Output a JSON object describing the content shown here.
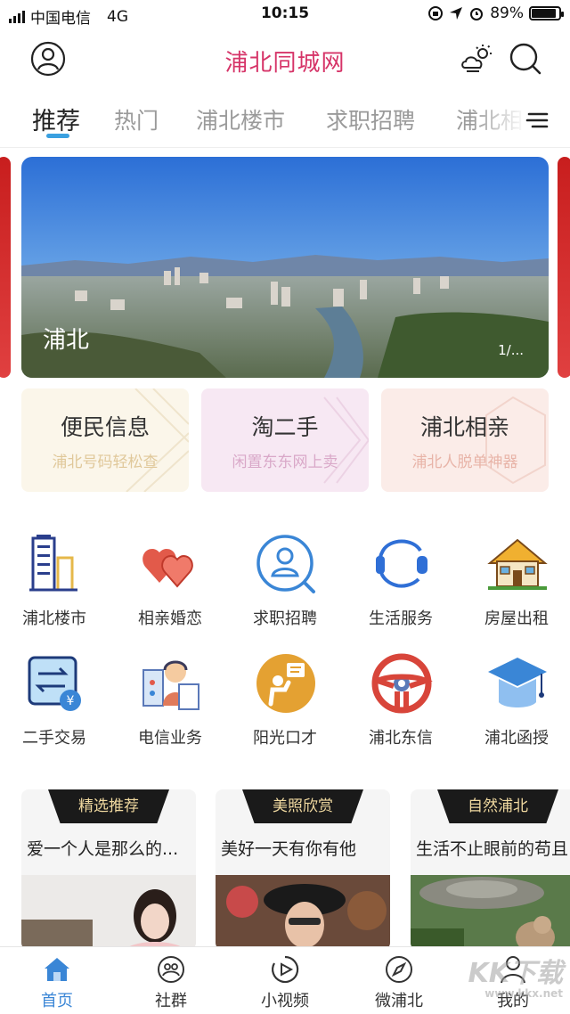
{
  "status_bar": {
    "carrier": "中国电信",
    "network": "4G",
    "time": "10:15",
    "battery": "89%",
    "battery_level": 0.89
  },
  "header": {
    "title": "浦北同城网"
  },
  "tabs": [
    {
      "label": "推荐",
      "active": true
    },
    {
      "label": "热门"
    },
    {
      "label": "浦北楼市"
    },
    {
      "label": "求职招聘"
    },
    {
      "label": "浦北相"
    }
  ],
  "banner": {
    "caption": "浦北",
    "page_indicator": "1/..."
  },
  "service_cards": [
    {
      "title": "便民信息",
      "subtitle": "浦北号码轻松查",
      "bg": "#fbf6ea",
      "subtitle_color": "#e0c89a"
    },
    {
      "title": "淘二手",
      "subtitle": "闲置东东网上卖",
      "bg": "#f7e8f3",
      "subtitle_color": "#d9a8c8"
    },
    {
      "title": "浦北相亲",
      "subtitle": "浦北人脱单神器",
      "bg": "#fbece8",
      "subtitle_color": "#e8b4a8"
    }
  ],
  "grid": [
    {
      "label": "浦北楼市",
      "icon": "building-icon"
    },
    {
      "label": "相亲婚恋",
      "icon": "hearts-icon"
    },
    {
      "label": "求职招聘",
      "icon": "job-search-icon"
    },
    {
      "label": "生活服务",
      "icon": "headset-icon"
    },
    {
      "label": "房屋出租",
      "icon": "house-icon"
    },
    {
      "label": "二手交易",
      "icon": "exchange-icon"
    },
    {
      "label": "电信业务",
      "icon": "telecom-agent-icon"
    },
    {
      "label": "阳光口才",
      "icon": "speech-icon"
    },
    {
      "label": "浦北东信",
      "icon": "steering-wheel-icon"
    },
    {
      "label": "浦北函授",
      "icon": "graduation-cap-icon"
    }
  ],
  "features": [
    {
      "tag": "精选推荐",
      "title": "爱一个人是那么的..."
    },
    {
      "tag": "美照欣赏",
      "title": "美好一天有你有他"
    },
    {
      "tag": "自然浦北",
      "title": "生活不止眼前的苟且"
    }
  ],
  "bottom_nav": [
    {
      "label": "首页",
      "icon": "home-icon",
      "active": true
    },
    {
      "label": "社群",
      "icon": "community-icon"
    },
    {
      "label": "小视频",
      "icon": "play-icon"
    },
    {
      "label": "微浦北",
      "icon": "compass-icon"
    },
    {
      "label": "我的",
      "icon": "profile-icon"
    }
  ],
  "watermark": {
    "text": "KK下载",
    "url": "www.kkx.net"
  },
  "colors": {
    "brand": "#d63468",
    "accent": "#3a86d6",
    "tab_underline": "#3aa0e0"
  }
}
